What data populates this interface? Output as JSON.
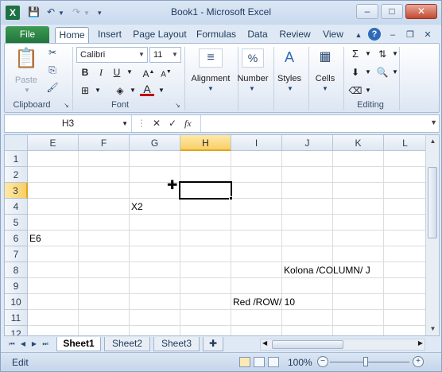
{
  "window": {
    "title": "Book1 - Microsoft Excel"
  },
  "qat": {
    "save_icon": "save-icon",
    "undo_icon": "undo-icon",
    "redo_icon": "redo-icon",
    "customize_icon": "chevron-down-icon"
  },
  "tabs": {
    "file": "File",
    "items": [
      "Home",
      "Insert",
      "Page Layout",
      "Formulas",
      "Data",
      "Review",
      "View"
    ],
    "active": "Home"
  },
  "ribbon": {
    "clipboard": {
      "paste": "Paste",
      "label": "Clipboard"
    },
    "font": {
      "name": "Calibri",
      "size": "11",
      "bold": "B",
      "italic": "I",
      "underline": "U",
      "label": "Font",
      "font_color": "#c00000"
    },
    "alignment": {
      "label": "Alignment"
    },
    "number": {
      "label": "Number",
      "symbol": "%"
    },
    "styles": {
      "label": "Styles"
    },
    "cells": {
      "label": "Cells"
    },
    "editing": {
      "label": "Editing",
      "sum": "Σ"
    }
  },
  "formula_bar": {
    "name_box": "H3",
    "fx": "fx",
    "value": ""
  },
  "grid": {
    "columns": [
      "E",
      "F",
      "G",
      "H",
      "I",
      "J",
      "K",
      "L"
    ],
    "selected_column": "H",
    "rows": [
      "1",
      "2",
      "3",
      "4",
      "5",
      "6",
      "7",
      "8",
      "9",
      "10",
      "11",
      "12"
    ],
    "selected_row": "3",
    "cells": {
      "G4": "X2",
      "E6": "E6",
      "J8": "Kolona /COLUMN/ J",
      "I10": "Red /ROW/ 10"
    }
  },
  "sheets": {
    "items": [
      "Sheet1",
      "Sheet2",
      "Sheet3"
    ],
    "active": "Sheet1"
  },
  "status": {
    "mode": "Edit",
    "zoom": "100%",
    "zoom_out": "−",
    "zoom_in": "+"
  }
}
